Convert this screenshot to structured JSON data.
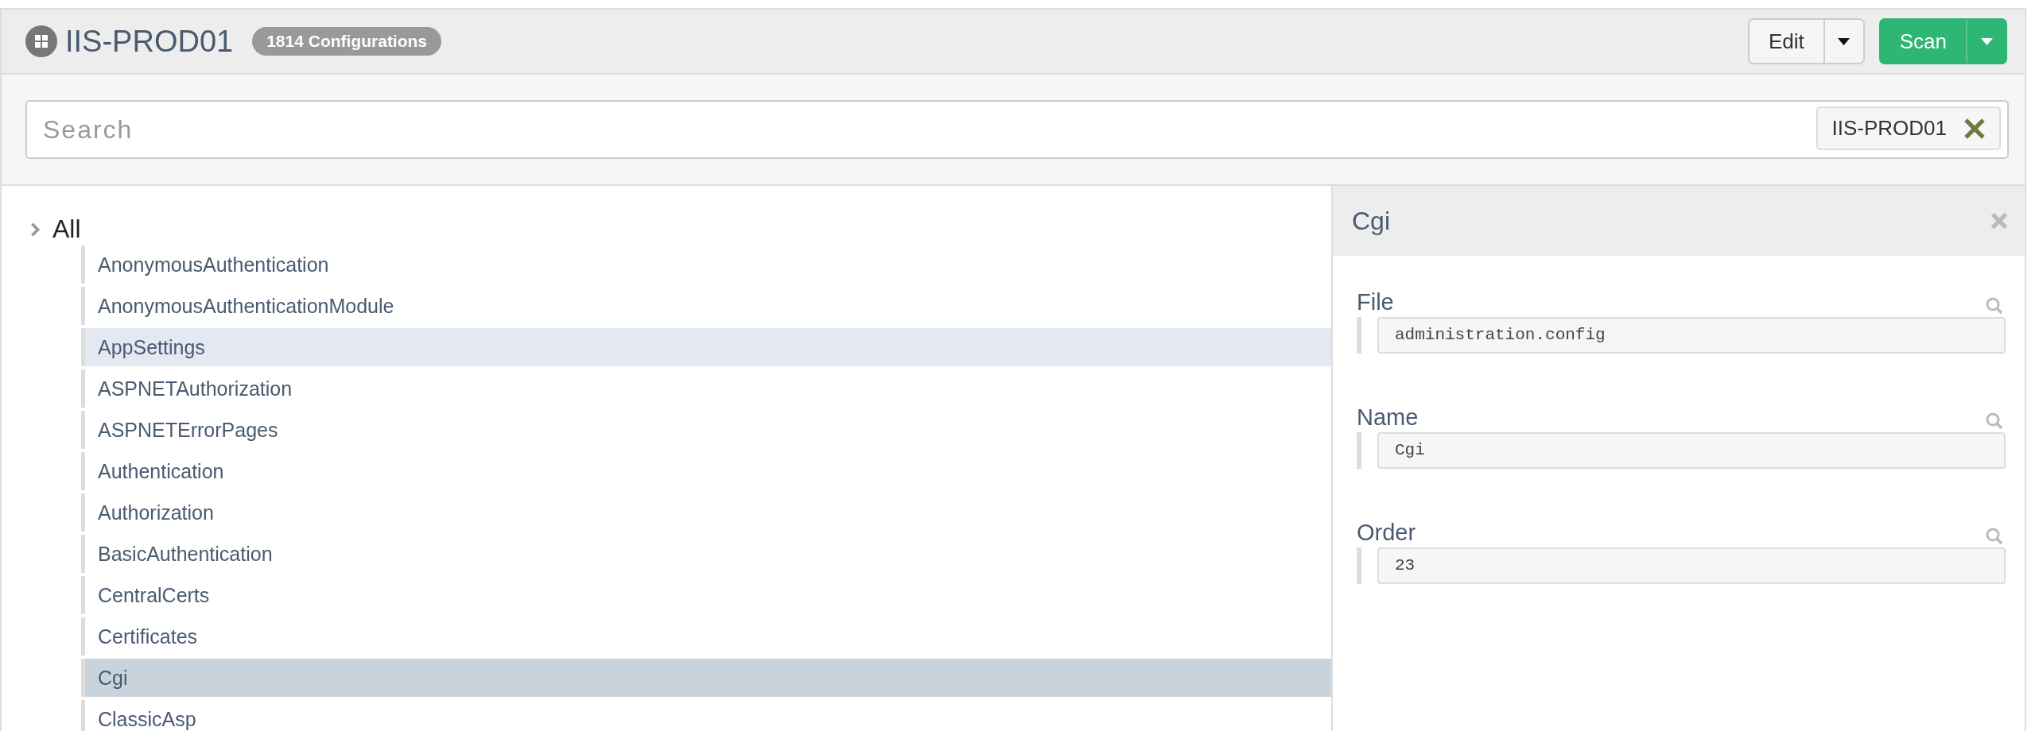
{
  "header": {
    "title": "IIS-PROD01",
    "badge": "1814 Configurations",
    "buttons": [
      {
        "label": "Edit",
        "kind": "default"
      },
      {
        "label": "Scan",
        "kind": "primary"
      }
    ]
  },
  "search": {
    "placeholder": "Search",
    "filter": "IIS-PROD01"
  },
  "tree": {
    "root": {
      "label": "All",
      "expanded": false
    },
    "items": [
      {
        "label": "AnonymousAuthentication",
        "selected": false,
        "hovered": false
      },
      {
        "label": "AnonymousAuthenticationModule",
        "selected": false,
        "hovered": false
      },
      {
        "label": "AppSettings",
        "selected": false,
        "hovered": true
      },
      {
        "label": "ASPNETAuthorization",
        "selected": false,
        "hovered": false
      },
      {
        "label": "ASPNETErrorPages",
        "selected": false,
        "hovered": false
      },
      {
        "label": "Authentication",
        "selected": false,
        "hovered": false
      },
      {
        "label": "Authorization",
        "selected": false,
        "hovered": false
      },
      {
        "label": "BasicAuthentication",
        "selected": false,
        "hovered": false
      },
      {
        "label": "CentralCerts",
        "selected": false,
        "hovered": false
      },
      {
        "label": "Certificates",
        "selected": false,
        "hovered": false
      },
      {
        "label": "Cgi",
        "selected": true,
        "hovered": false
      },
      {
        "label": "ClassicAsp",
        "selected": false,
        "hovered": false
      }
    ]
  },
  "detail": {
    "title": "Cgi",
    "fields": [
      {
        "label": "File",
        "value": "administration.config"
      },
      {
        "label": "Name",
        "value": "Cgi"
      },
      {
        "label": "Order",
        "value": "23"
      }
    ]
  }
}
